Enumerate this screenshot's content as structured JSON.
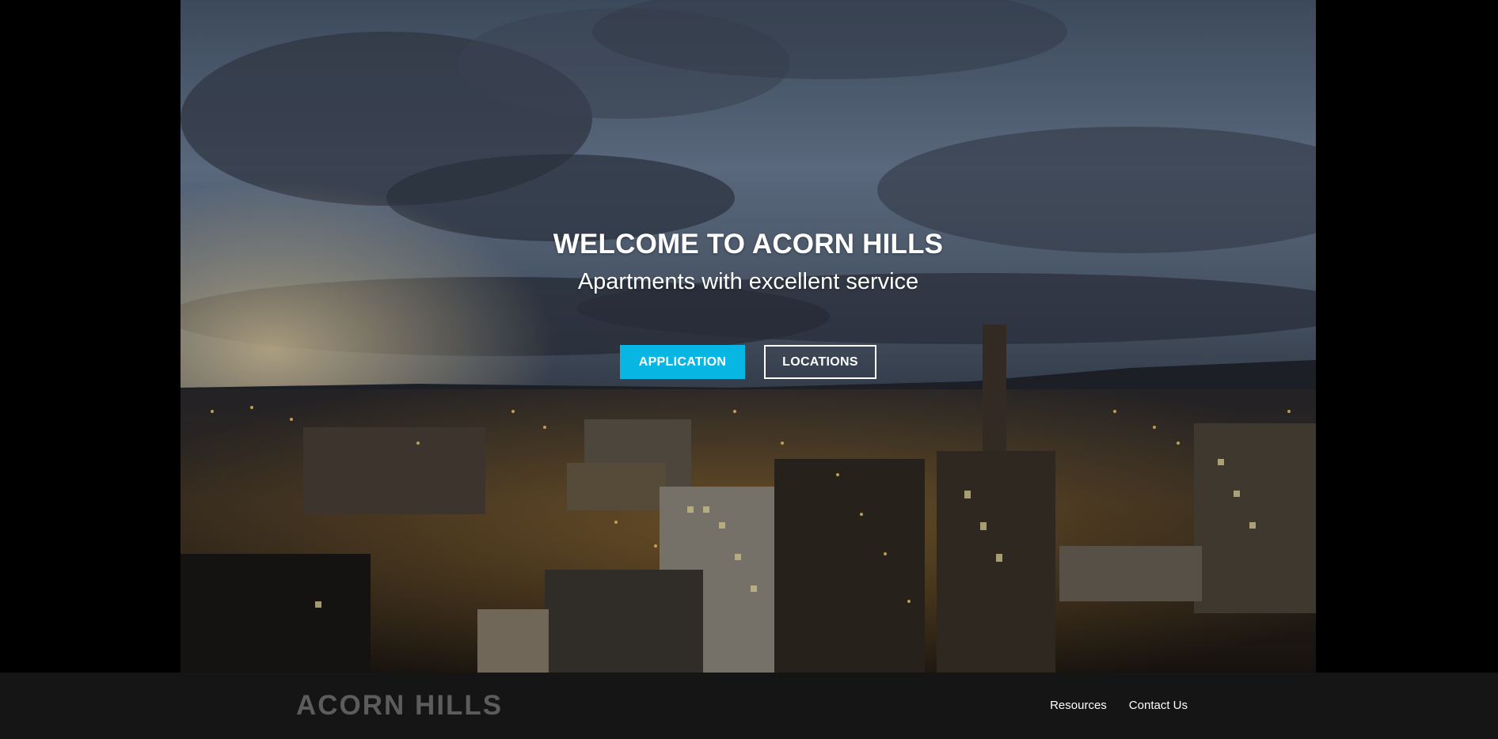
{
  "hero": {
    "title": "WELCOME TO ACORN HILLS",
    "subtitle": "Apartments with excellent service",
    "buttons": {
      "application": "APPLICATION",
      "locations": "LOCATIONS"
    },
    "background": "night-city-skyline-image"
  },
  "footer": {
    "brand": "ACORN HILLS",
    "nav": {
      "resources": "Resources",
      "contact": "Contact Us"
    }
  },
  "colors": {
    "accent": "#08b6e4",
    "footer_bg": "#151515",
    "brand_text": "#5c5c5c",
    "page_bg": "#000000"
  }
}
